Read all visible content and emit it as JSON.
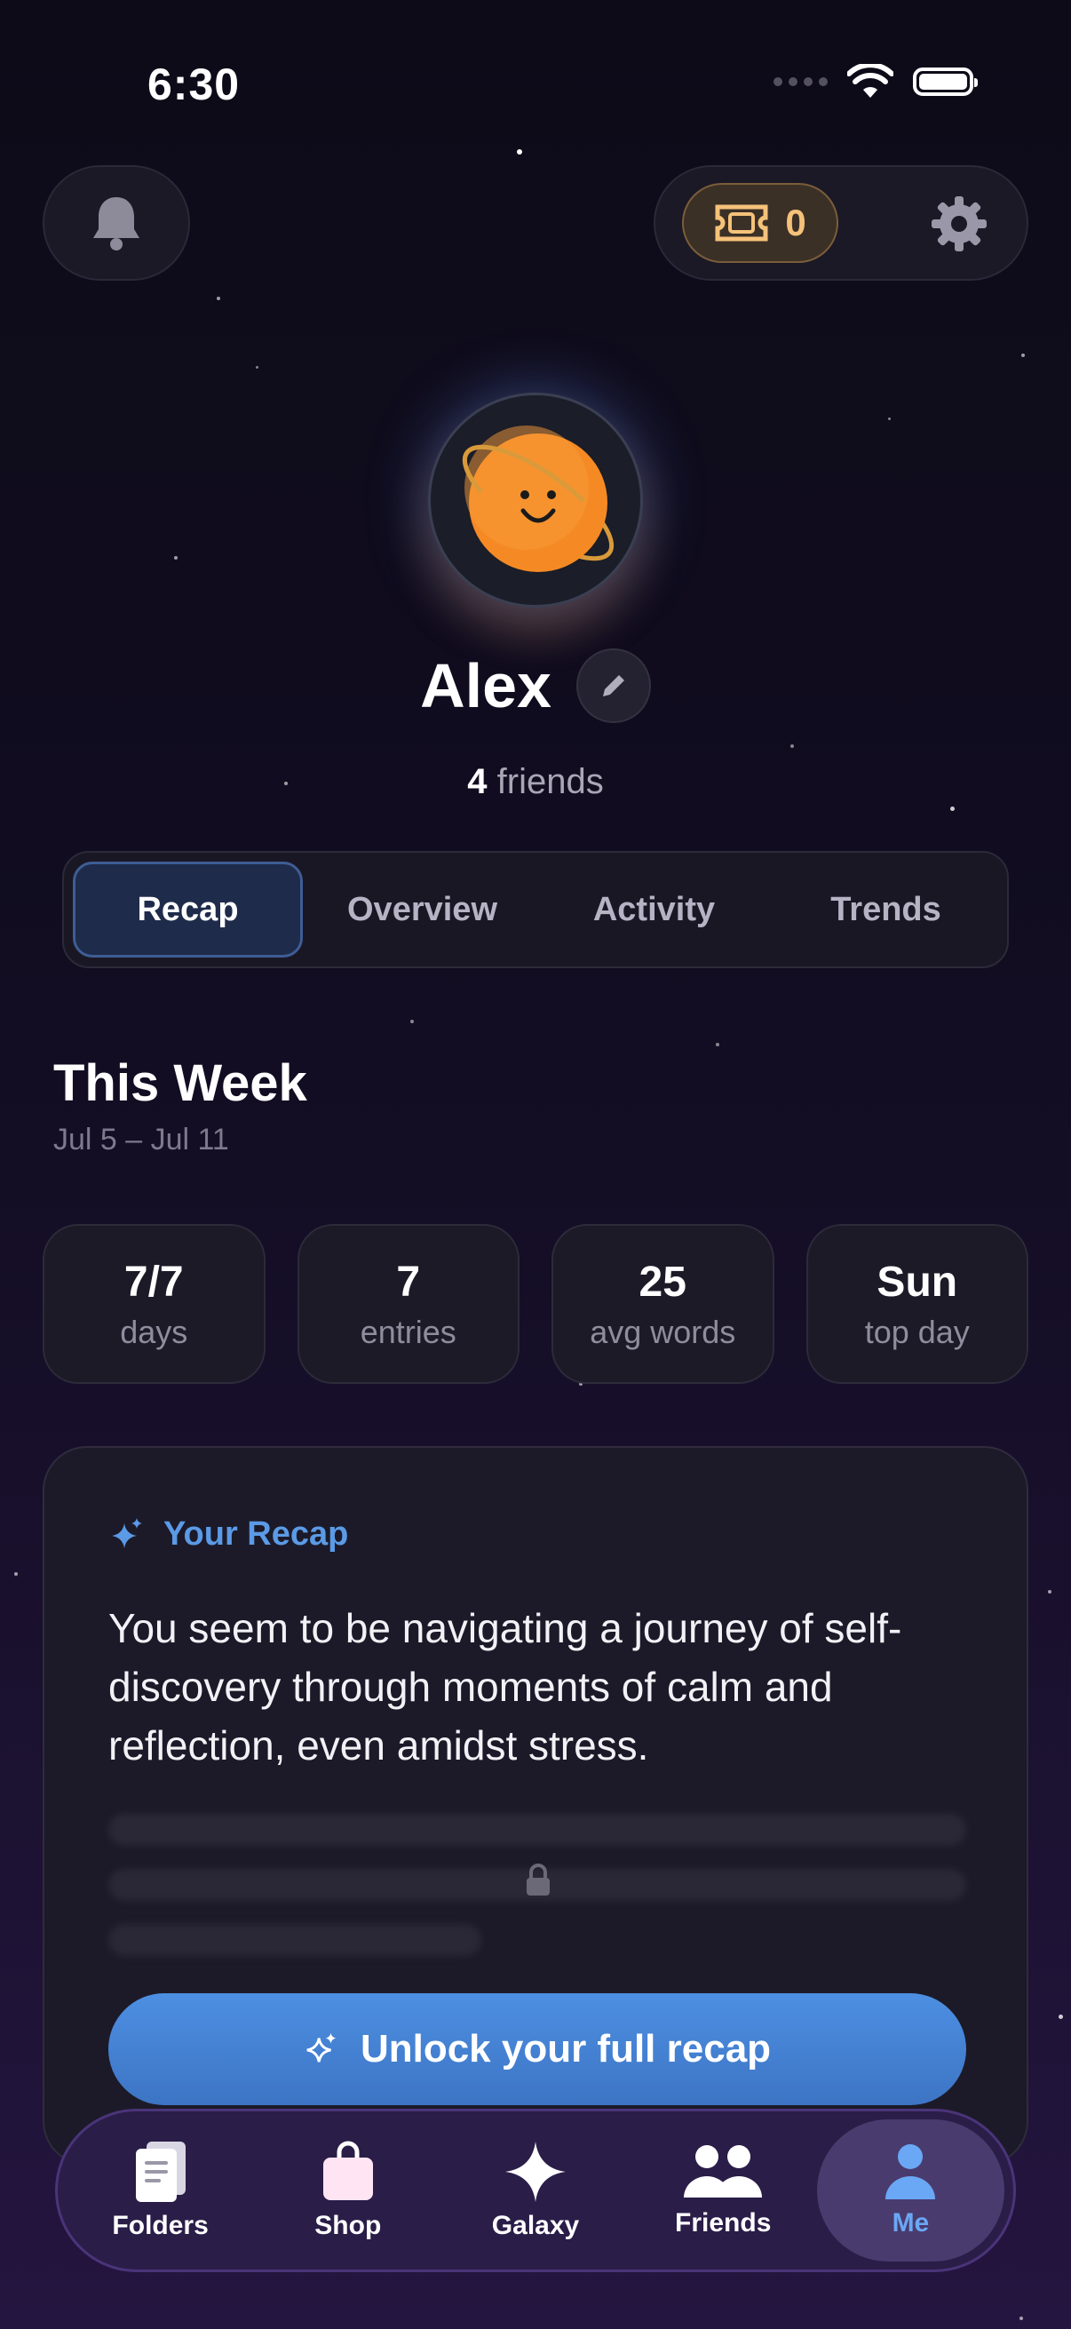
{
  "status_bar": {
    "time": "6:30"
  },
  "header": {
    "ticket_count": "0"
  },
  "profile": {
    "name": "Alex",
    "friends_count": "4",
    "friends_label": "friends"
  },
  "tabs": [
    {
      "label": "Recap",
      "active": true
    },
    {
      "label": "Overview",
      "active": false
    },
    {
      "label": "Activity",
      "active": false
    },
    {
      "label": "Trends",
      "active": false
    }
  ],
  "week": {
    "title": "This Week",
    "range": "Jul 5 – Jul 11"
  },
  "stats": [
    {
      "value": "7/7",
      "label": "days"
    },
    {
      "value": "7",
      "label": "entries"
    },
    {
      "value": "25",
      "label": "avg words"
    },
    {
      "value": "Sun",
      "label": "top day"
    }
  ],
  "recap": {
    "heading": "Your Recap",
    "text": "You seem to be navigating a journey of self-discovery through moments of calm and reflection, even amidst stress.",
    "unlock_label": "Unlock your full recap"
  },
  "nav": [
    {
      "label": "Folders",
      "icon": "folders-icon"
    },
    {
      "label": "Shop",
      "icon": "shop-icon"
    },
    {
      "label": "Galaxy",
      "icon": "galaxy-icon"
    },
    {
      "label": "Friends",
      "icon": "friends-icon"
    },
    {
      "label": "Me",
      "icon": "me-icon",
      "active": true
    }
  ],
  "colors": {
    "accent": "#5b9ae6",
    "ticket": "#f5c27a",
    "planet": "#f58a24",
    "nav_bg": "#2a1d48"
  }
}
